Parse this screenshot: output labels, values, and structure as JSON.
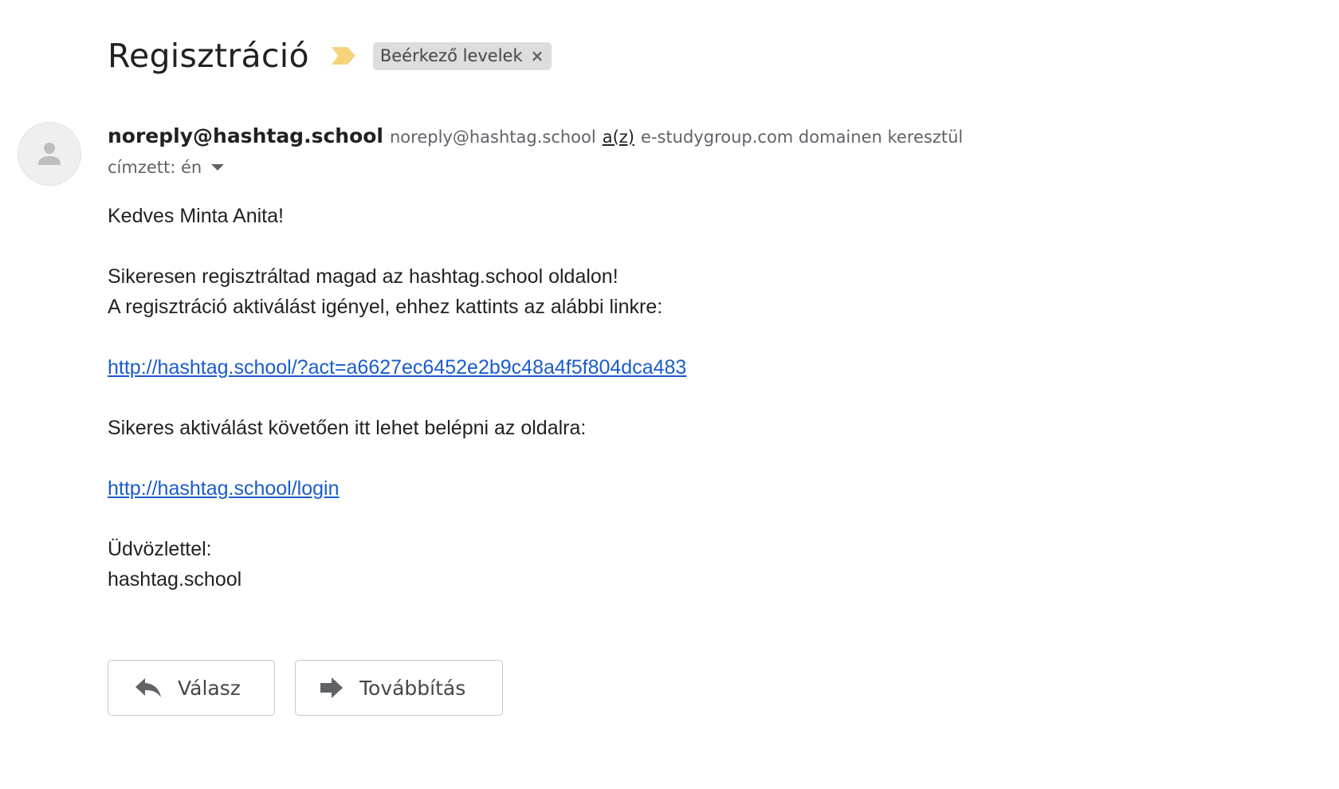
{
  "email": {
    "subject": "Regisztráció",
    "label_chip": "Beérkező levelek",
    "label_close_glyph": "×",
    "sender": {
      "name": "noreply@hashtag.school",
      "address": "noreply@hashtag.school",
      "via_link": "a(z)",
      "via_text": "e-studygroup.com domainen keresztül"
    },
    "recipient": "címzett: én",
    "body": {
      "greeting": "Kedves Minta Anita!",
      "line1": "Sikeresen regisztráltad magad az hashtag.school oldalon!",
      "line2": "A regisztráció aktiválást igényel, ehhez kattints az alábbi linkre:",
      "activation_link": "http://hashtag.school/?act=a6627ec6452e2b9c48a4f5f804dca483",
      "line3": "Sikeres aktiválást követően itt lehet belépni az oldalra:",
      "login_link": "http://hashtag.school/login",
      "closing": "Üdvözlettel:",
      "signature": "hashtag.school"
    },
    "actions": {
      "reply_label": "Válasz",
      "forward_label": "Továbbítás"
    }
  },
  "icons": {
    "importance": "importance-marker-icon",
    "avatar": "person-icon",
    "caret": "caret-down-icon",
    "reply": "reply-icon",
    "forward": "forward-icon"
  },
  "colors": {
    "importance": "#f6d47d",
    "link": "#1a5ccc",
    "chip_bg": "#dddddd"
  }
}
